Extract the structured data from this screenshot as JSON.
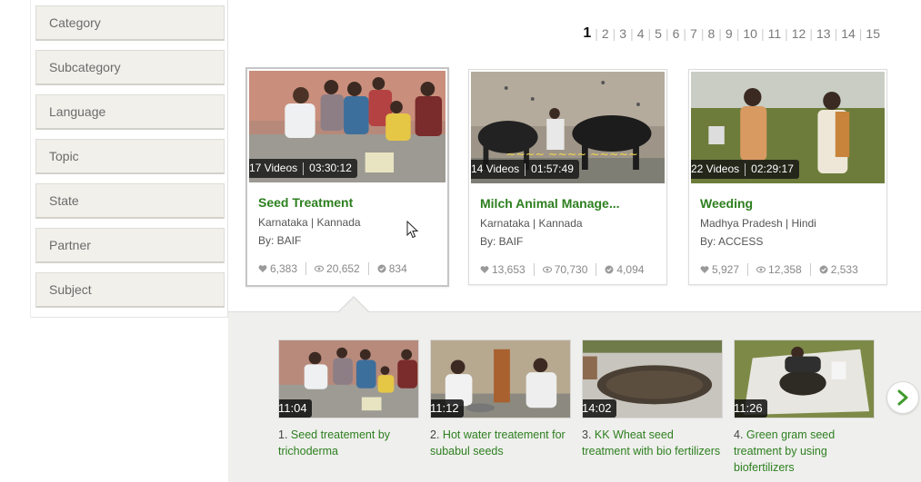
{
  "filters": [
    {
      "label": "Category"
    },
    {
      "label": "Subcategory"
    },
    {
      "label": "Language"
    },
    {
      "label": "Topic"
    },
    {
      "label": "State"
    },
    {
      "label": "Partner"
    },
    {
      "label": "Subject"
    }
  ],
  "pagination": {
    "current": "1",
    "pages": [
      "1",
      "2",
      "3",
      "4",
      "5",
      "6",
      "7",
      "8",
      "9",
      "10",
      "11",
      "12",
      "13",
      "14",
      "15"
    ],
    "separator": "|"
  },
  "cards": [
    {
      "videos": "17 Videos",
      "duration": "03:30:12",
      "title": "Seed Treatment",
      "location": "Karnataka | Kannada",
      "by": "By: BAIF",
      "likes": "6,383",
      "views": "20,652",
      "adoptions": "834"
    },
    {
      "videos": "14 Videos",
      "duration": "01:57:49",
      "title": "Milch Animal Manage...",
      "location": "Karnataka | Kannada",
      "by": "By: BAIF",
      "likes": "13,653",
      "views": "70,730",
      "adoptions": "4,094"
    },
    {
      "videos": "22 Videos",
      "duration": "02:29:17",
      "title": "Weeding",
      "location": "Madhya Pradesh | Hindi",
      "by": "By: ACCESS",
      "likes": "5,927",
      "views": "12,358",
      "adoptions": "2,533"
    }
  ],
  "videos": [
    {
      "duration": "11:04",
      "num": "1.",
      "title": "Seed treatement by trichoderma"
    },
    {
      "duration": "11:12",
      "num": "2.",
      "title": "Hot water treatement for subabul seeds"
    },
    {
      "duration": "14:02",
      "num": "3.",
      "title": "KK Wheat seed treatment with bio fertilizers"
    },
    {
      "duration": "11:26",
      "num": "4.",
      "title": "Green gram seed treatment by using biofertilizers"
    }
  ],
  "icons": {
    "likes": "heart-icon",
    "views": "eye-icon",
    "adoptions": "check-circle-icon",
    "next": "chevron-right-icon"
  },
  "colors": {
    "title_green": "#2d7f1f",
    "panel_bg": "#efefed",
    "filter_bg": "#f1f0eb"
  }
}
